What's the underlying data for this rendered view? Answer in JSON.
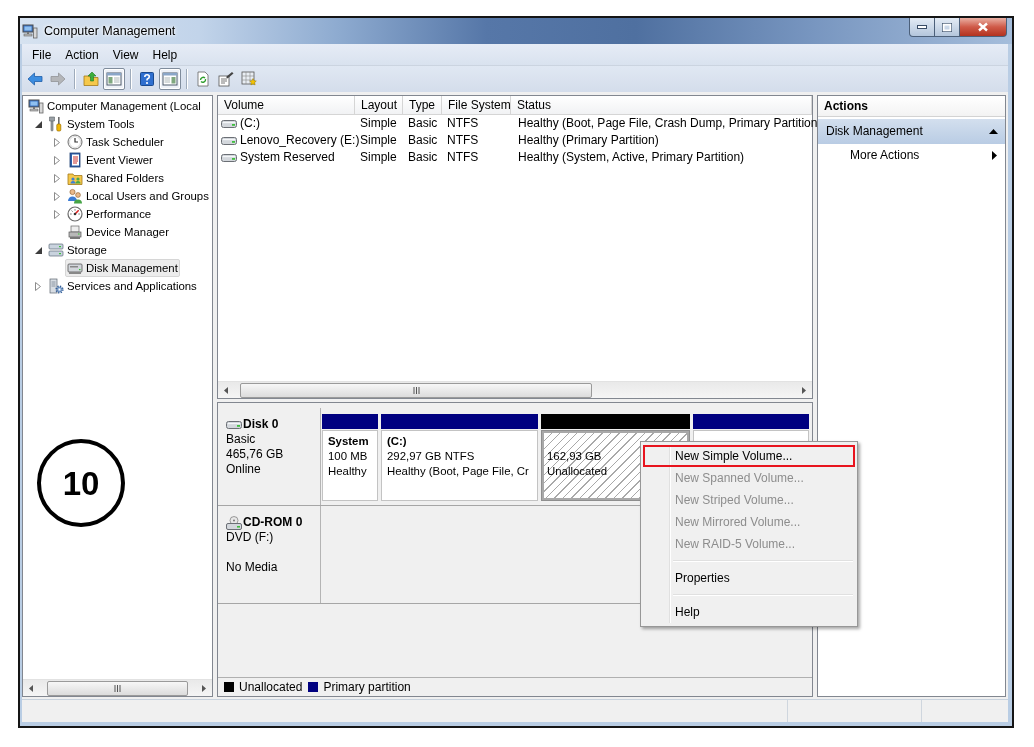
{
  "window": {
    "title": "Computer Management"
  },
  "menu_bar": [
    {
      "label": "File"
    },
    {
      "label": "Action"
    },
    {
      "label": "View"
    },
    {
      "label": "Help"
    }
  ],
  "toolbar": [
    [
      {
        "kind": "back",
        "disabled": false,
        "pressed": false
      },
      {
        "kind": "forward",
        "disabled": true,
        "pressed": false
      }
    ],
    [
      {
        "kind": "up",
        "disabled": false,
        "pressed": false
      },
      {
        "kind": "console_tree",
        "disabled": false,
        "pressed": true
      }
    ],
    [
      {
        "kind": "help",
        "disabled": false,
        "pressed": false
      },
      {
        "kind": "action_pane",
        "disabled": false,
        "pressed": true
      }
    ],
    [
      {
        "kind": "refresh",
        "disabled": false,
        "pressed": false
      },
      {
        "kind": "properties",
        "disabled": false,
        "pressed": false
      },
      {
        "kind": "settings",
        "disabled": false,
        "pressed": false
      }
    ]
  ],
  "tree": {
    "items": [
      {
        "label": "Computer Management (Local",
        "kind": "computer",
        "selected": false,
        "children": [
          {
            "label": "System Tools",
            "kind": "tools",
            "expanded": true,
            "selected": false,
            "children": [
              {
                "label": "Task Scheduler",
                "kind": "clock",
                "expanded": false,
                "selected": false
              },
              {
                "label": "Event Viewer",
                "kind": "log",
                "expanded": false,
                "selected": false
              },
              {
                "label": "Shared Folders",
                "kind": "shared",
                "expanded": false,
                "selected": false
              },
              {
                "label": "Local Users and Groups",
                "kind": "users",
                "expanded": false,
                "selected": false
              },
              {
                "label": "Performance",
                "kind": "gauge",
                "expanded": false,
                "selected": false
              },
              {
                "label": "Device Manager",
                "kind": "device",
                "selected": false
              }
            ]
          },
          {
            "label": "Storage",
            "kind": "storage",
            "expanded": true,
            "selected": false,
            "children": [
              {
                "label": "Disk Management",
                "kind": "disk",
                "selected": true
              }
            ]
          },
          {
            "label": "Services and Applications",
            "kind": "services",
            "expanded": false,
            "selected": false
          }
        ]
      }
    ]
  },
  "volume_list": {
    "columns": [
      "Volume",
      "Layout",
      "Type",
      "File System",
      "Status"
    ],
    "rows": [
      [
        "(C:)",
        "Simple",
        "Basic",
        "NTFS",
        "Healthy (Boot, Page File, Crash Dump, Primary Partition"
      ],
      [
        "Lenovo_Recovery (E:)",
        "Simple",
        "Basic",
        "NTFS",
        "Healthy (Primary Partition)"
      ],
      [
        "System Reserved",
        "Simple",
        "Basic",
        "NTFS",
        "Healthy (System, Active, Primary Partition)"
      ]
    ]
  },
  "disks": [
    {
      "kind": "disk",
      "name": "Disk 0",
      "type": "Basic",
      "size": "465,76 GB",
      "status": "Online",
      "partitions": [
        {
          "kind": "primary",
          "selected": false,
          "name": "System",
          "size": "100 MB",
          "status": "Healthy"
        },
        {
          "kind": "primary",
          "selected": false,
          "name": "(C:)",
          "size": "292,97 GB NTFS",
          "status": "Healthy (Boot, Page File, Cr"
        },
        {
          "kind": "unallocated",
          "selected": true,
          "size": "162,93 GB",
          "status": "Unallocated"
        },
        {
          "kind": "primary",
          "selected": false
        }
      ]
    },
    {
      "kind": "cdrom",
      "name": "CD-ROM 0",
      "type": "DVD (F:)",
      "status": "No Media"
    }
  ],
  "legend": [
    {
      "label": "Unallocated",
      "color": "#000000"
    },
    {
      "label": "Primary partition",
      "color": "#000080"
    }
  ],
  "actions": {
    "title": "Actions",
    "sections": [
      {
        "label": "Disk Management",
        "expanded": true,
        "items": [
          {
            "label": "More Actions",
            "submenu": true
          }
        ]
      }
    ]
  },
  "context_menu": {
    "items": [
      {
        "kind": "item",
        "label": "New Simple Volume...",
        "disabled": false,
        "highlighted": true
      },
      {
        "kind": "item",
        "label": "New Spanned Volume...",
        "disabled": true,
        "highlighted": false
      },
      {
        "kind": "item",
        "label": "New Striped Volume...",
        "disabled": true,
        "highlighted": false
      },
      {
        "kind": "item",
        "label": "New Mirrored Volume...",
        "disabled": true,
        "highlighted": false
      },
      {
        "kind": "item",
        "label": "New RAID-5 Volume...",
        "disabled": true,
        "highlighted": false
      },
      {
        "kind": "separator"
      },
      {
        "kind": "item",
        "label": "Properties",
        "disabled": false,
        "highlighted": false
      },
      {
        "kind": "separator"
      },
      {
        "kind": "item",
        "label": "Help",
        "disabled": false,
        "highlighted": false
      }
    ]
  },
  "step_badge": {
    "label": "10"
  }
}
